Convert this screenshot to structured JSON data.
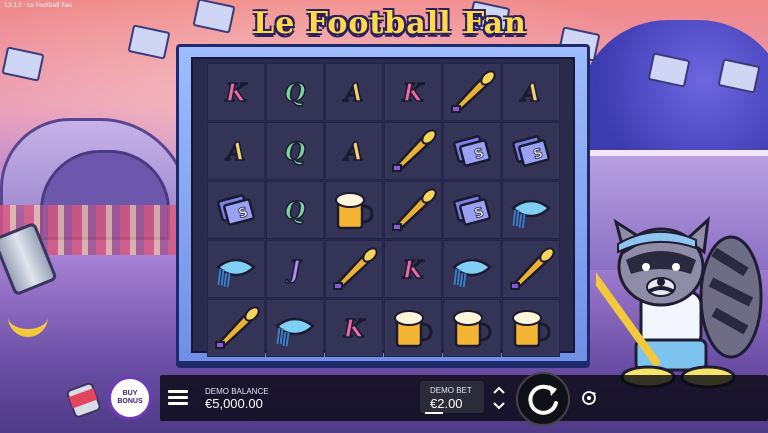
{
  "game": {
    "title": "Le Football Fan",
    "top_left_text": "13:13 · Le Football Fan"
  },
  "reels": {
    "rows": [
      [
        "K",
        "Q",
        "A",
        "K",
        "horn",
        "A"
      ],
      [
        "A",
        "Q",
        "A",
        "horn",
        "tickets",
        "tickets"
      ],
      [
        "tickets",
        "Q",
        "beer",
        "horn",
        "tickets",
        "scarf"
      ],
      [
        "scarf",
        "J",
        "horn",
        "K",
        "scarf",
        "horn"
      ],
      [
        "horn",
        "scarf",
        "K",
        "beer",
        "beer",
        "beer"
      ]
    ],
    "symbol_icons": {
      "horn": "vuvuzela-horn-icon",
      "tickets": "ticket-stack-icon",
      "beer": "beer-mug-icon",
      "scarf": "football-scarf-icon"
    }
  },
  "controls": {
    "buy_bonus_line1": "BUY",
    "buy_bonus_line2": "BONUS",
    "balance_label": "DEMO BALANCE",
    "balance_value": "€5,000.00",
    "bet_label": "DEMO BET",
    "bet_value": "€2.00",
    "bet_up_icon": "chevron-up-icon",
    "bet_down_icon": "chevron-down-icon",
    "spin_icon": "spin-arrow-icon",
    "autoplay_icon": "autoplay-icon",
    "menu_icon": "hamburger-menu-icon"
  },
  "colors": {
    "title": "#ffd94a",
    "letter_K": "#f06aa6",
    "letter_Q": "#7ad39a",
    "letter_A": "#f2d070",
    "letter_J": "#b58af0",
    "buy_bonus_ring": "#6d3bb5"
  }
}
